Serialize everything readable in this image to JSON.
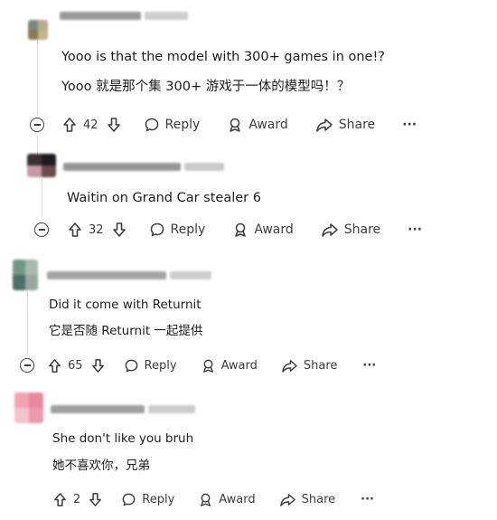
{
  "comments": [
    {
      "text_en": "Yooo is that the model with 300+ games in one!?",
      "text_zh": "Yooo 就是那个集 300+ 游戏于一体的模型吗！？",
      "upvotes": "42",
      "reply": "Reply",
      "award": "Award",
      "share": "Share",
      "more": "···"
    },
    {
      "text_en": "Waitin on Grand Car stealer 6",
      "upvotes": "32",
      "reply": "Reply",
      "award": "Award",
      "share": "Share",
      "more": "···"
    },
    {
      "text_en": "Did it come with Returnit",
      "text_zh": "它是否随 Returnit 一起提供",
      "upvotes": "65",
      "reply": "Reply",
      "award": "Award",
      "share": "Share",
      "more": "···"
    },
    {
      "text_en": "She don't like you bruh",
      "text_zh": "她不喜欢你，兄弟",
      "upvotes": "2",
      "reply": "Reply",
      "award": "Award",
      "share": "Share",
      "more": "···"
    }
  ],
  "colors": {
    "thread_line": "#d7dadc",
    "icon": "#3c3c3c",
    "text": "#1c1c1c"
  }
}
